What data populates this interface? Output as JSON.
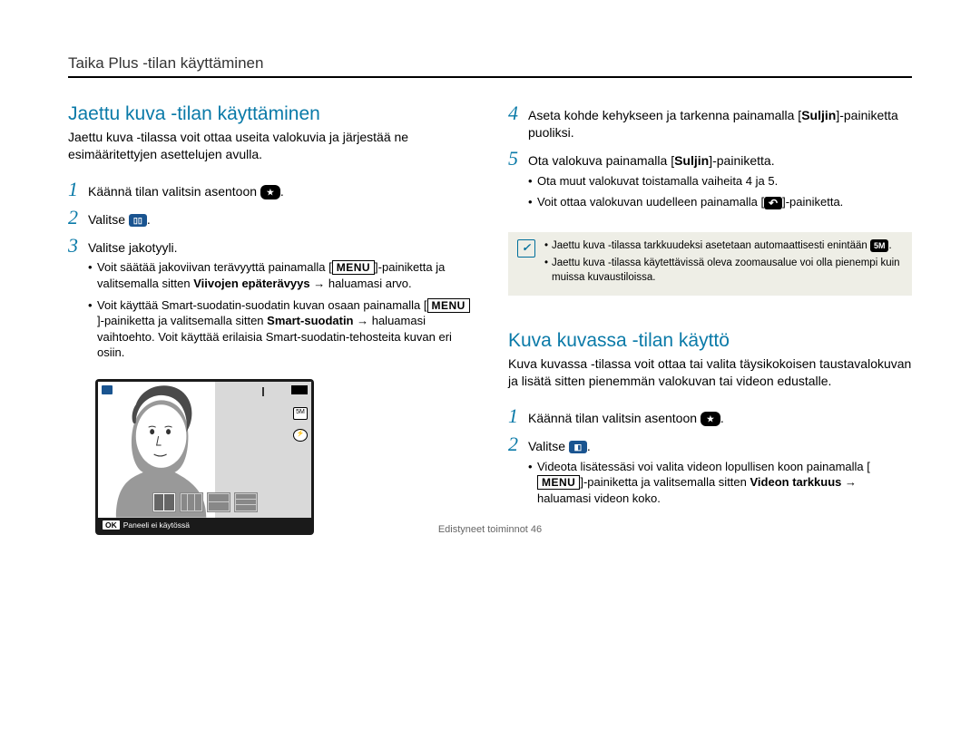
{
  "header": "Taika Plus -tilan käyttäminen",
  "footer": "Edistyneet toiminnot  46",
  "left": {
    "title": "Jaettu kuva -tilan käyttäminen",
    "intro": "Jaettu kuva -tilassa voit ottaa useita valokuvia ja järjestää ne esimääritettyjen asettelujen avulla.",
    "step1_a": "Käännä tilan valitsin asentoon ",
    "step1_b": ".",
    "step2_a": "Valitse ",
    "step2_b": ".",
    "step3": "Valitse jakotyyli.",
    "bullet1_a": "Voit säätää jakoviivan terävyyttä painamalla [",
    "bullet1_menu": "MENU",
    "bullet1_b": "]-painiketta ja valitsemalla sitten ",
    "bullet1_bold": "Viivojen epäterävyys",
    "bullet1_c": " → haluamasi arvo.",
    "bullet2_a": "Voit käyttää Smart-suodatin-suodatin kuvan osaan painamalla [",
    "bullet2_menu": "MENU",
    "bullet2_b": "]-painiketta ja valitsemalla sitten ",
    "bullet2_bold": "Smart-suodatin",
    "bullet2_c": " → haluamasi vaihtoehto. Voit käyttää erilaisia Smart-suodatin-tehosteita kuvan eri osiin.",
    "caption_ok": "OK",
    "caption_text": "Paneeli ei käytössä"
  },
  "right": {
    "step4_a": "Aseta kohde kehykseen ja tarkenna painamalla [",
    "step4_bold": "Suljin",
    "step4_b": "]-painiketta puoliksi.",
    "step5_a": "Ota valokuva painamalla [",
    "step5_bold": "Suljin",
    "step5_b": "]-painiketta.",
    "sub1": "Ota muut valokuvat toistamalla vaiheita 4 ja 5.",
    "sub2_a": "Voit ottaa valokuvan uudelleen painamalla [",
    "sub2_b": "]-painiketta.",
    "note1_a": "Jaettu kuva -tilassa tarkkuudeksi asetetaan automaattisesti enintään ",
    "note1_b": ".",
    "note2": "Jaettu kuva -tilassa käytettävissä oleva zoomausalue voi olla pienempi kuin muissa kuvaustiloissa.",
    "title2": "Kuva kuvassa -tilan käyttö",
    "intro2": "Kuva kuvassa -tilassa voit ottaa tai valita täysikokoisen taustavalokuvan ja lisätä sitten pienemmän valokuvan tai videon edustalle.",
    "s1_a": "Käännä tilan valitsin asentoon ",
    "s1_b": ".",
    "s2_a": "Valitse ",
    "s2_b": ".",
    "sub3_a": "Videota lisätessäsi voi valita videon lopullisen koon painamalla [",
    "sub3_menu": "MENU",
    "sub3_b": "]-painiketta ja valitsemalla sitten ",
    "sub3_bold": "Videon tarkkuus",
    "sub3_c": " → haluamasi videon koko."
  }
}
